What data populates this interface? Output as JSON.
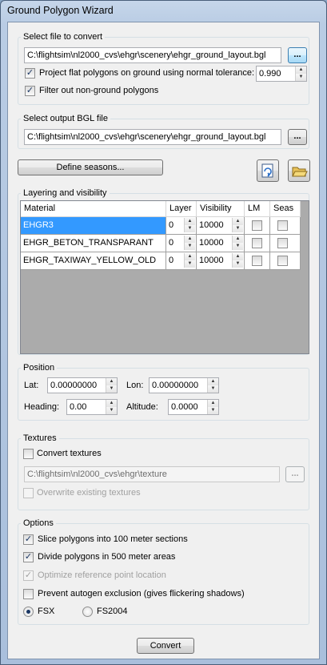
{
  "window": {
    "title": "Ground Polygon Wizard"
  },
  "input_file": {
    "group_title": "Select file to convert",
    "path": "C:\\flightsim\\nl2000_cvs\\ehgr\\scenery\\ehgr_ground_layout.bgl",
    "browse_label": "...",
    "project_label": "Project flat polygons on ground using normal tolerance:",
    "project_checked": true,
    "tolerance": "0.990",
    "filter_label": "Filter out non-ground polygons",
    "filter_checked": true
  },
  "output_file": {
    "group_title": "Select output BGL file",
    "path": "C:\\flightsim\\nl2000_cvs\\ehgr\\scenery\\ehgr_ground_layout.bgl",
    "browse_label": "..."
  },
  "define_seasons_label": "Define seasons...",
  "layering": {
    "group_title": "Layering and visibility",
    "columns": [
      "Material",
      "Layer",
      "Visibility",
      "LM",
      "Seas"
    ],
    "rows": [
      {
        "material": "EHGR3",
        "layer": "0",
        "visibility": "10000",
        "lm": false,
        "seas": false,
        "selected": true
      },
      {
        "material": "EHGR_BETON_TRANSPARANT",
        "layer": "0",
        "visibility": "10000",
        "lm": false,
        "seas": false,
        "selected": false
      },
      {
        "material": "EHGR_TAXIWAY_YELLOW_OLD",
        "layer": "0",
        "visibility": "10000",
        "lm": false,
        "seas": false,
        "selected": false
      }
    ]
  },
  "position": {
    "group_title": "Position",
    "lat_label": "Lat:",
    "lat": "0.00000000",
    "lon_label": "Lon:",
    "lon": "0.00000000",
    "heading_label": "Heading:",
    "heading": "0.00",
    "altitude_label": "Altitude:",
    "altitude": "0.0000"
  },
  "textures": {
    "group_title": "Textures",
    "convert_label": "Convert textures",
    "convert_checked": false,
    "path": "C:\\flightsim\\nl2000_cvs\\ehgr\\texture",
    "browse_label": "...",
    "overwrite_label": "Overwrite existing textures",
    "overwrite_checked": false
  },
  "options": {
    "group_title": "Options",
    "slice_label": "Slice polygons into 100 meter sections",
    "slice_checked": true,
    "divide_label": "Divide polygons in 500 meter areas",
    "divide_checked": true,
    "optimize_label": "Optimize reference point location",
    "optimize_checked": true,
    "prevent_label": "Prevent autogen exclusion (gives flickering shadows)",
    "prevent_checked": false,
    "fsx_label": "FSX",
    "fs2004_label": "FS2004",
    "selected_format": "FSX"
  },
  "convert_label": "Convert",
  "colors": {
    "selection": "#3399ff",
    "grid_background": "#ababab",
    "window_frame": "#b9cce4"
  },
  "icons": {
    "reload": "reload-file-icon",
    "open": "open-folder-icon",
    "spin_up": "spin-up-icon",
    "spin_down": "spin-down-icon"
  }
}
